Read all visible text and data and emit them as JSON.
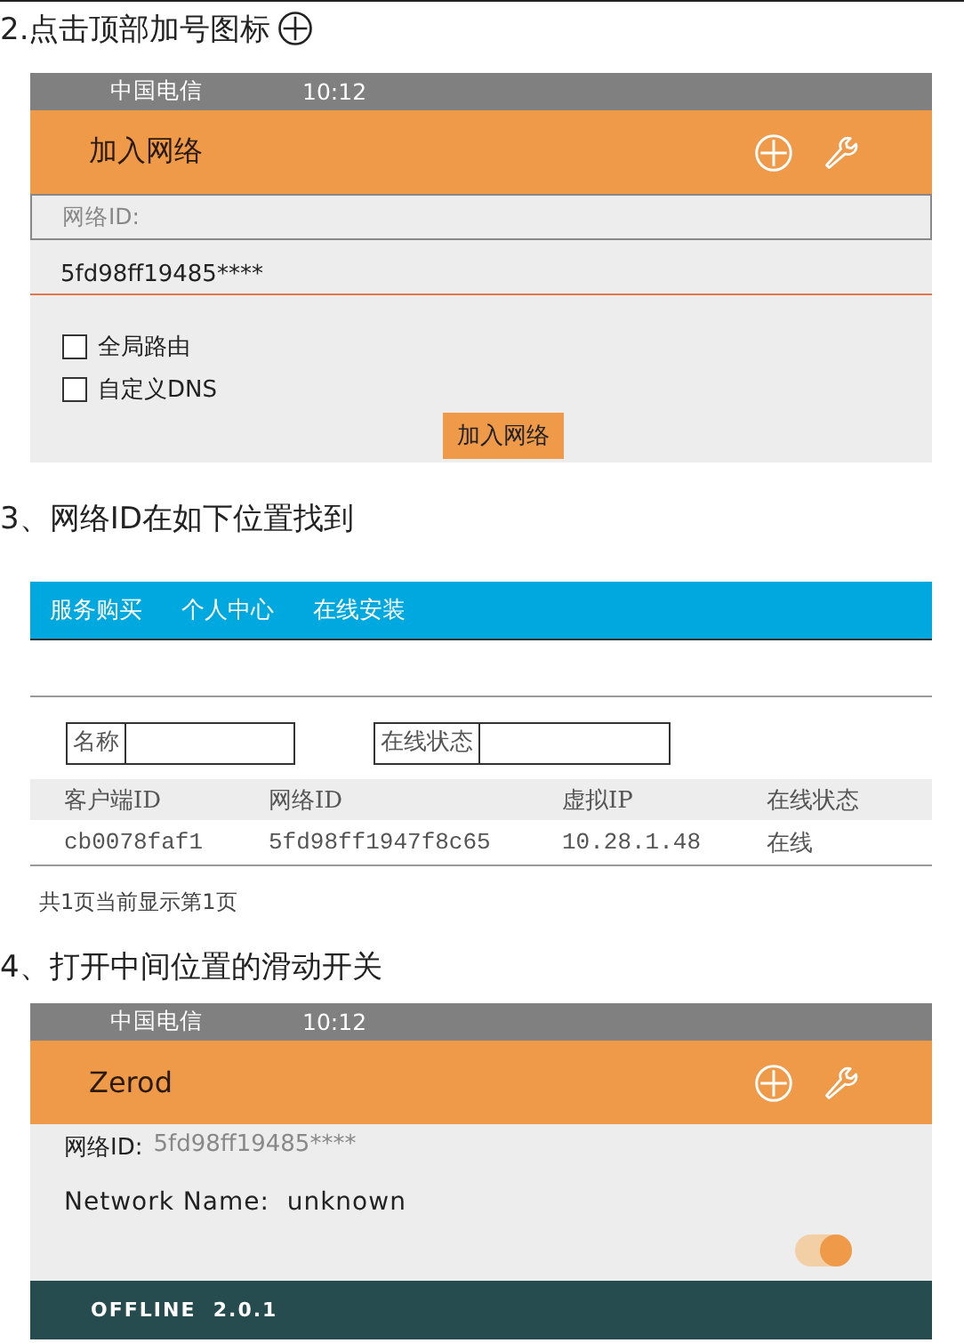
{
  "step2": {
    "heading": "2.点击顶部加号图标",
    "phone": {
      "carrier": "中国电信",
      "time": "10:12",
      "title": "加入网络",
      "field_label": "网络ID:",
      "field_value": "5fd98ff19485****",
      "options": [
        {
          "label": "全局路由",
          "checked": false
        },
        {
          "label": "自定义DNS",
          "checked": false
        }
      ],
      "button": "加入网络"
    }
  },
  "step3": {
    "heading": "3、网络ID在如下位置找到",
    "nav": [
      {
        "label": "服务购买"
      },
      {
        "label": "个人中心"
      },
      {
        "label": "在线安装"
      }
    ],
    "filters": [
      {
        "label": "名称"
      },
      {
        "label": "在线状态"
      }
    ],
    "table": {
      "columns": [
        "客户端ID",
        "网络ID",
        "虚拟IP",
        "在线状态"
      ],
      "rows": [
        [
          "cb0078faf1",
          "5fd98ff1947f8c65",
          "10.28.1.48",
          "在线"
        ]
      ]
    },
    "pagination": "共1页当前显示第1页"
  },
  "step4": {
    "heading": "4、打开中间位置的滑动开关",
    "phone": {
      "carrier": "中国电信",
      "time": "10:12",
      "title": "Zerod",
      "id_label": "网络ID:",
      "id_value": "5fd98ff19485****",
      "name_line": "Network Name:  unknown",
      "toggle": {
        "on": true
      },
      "status": "OFFLINE  2.0.1"
    }
  }
}
